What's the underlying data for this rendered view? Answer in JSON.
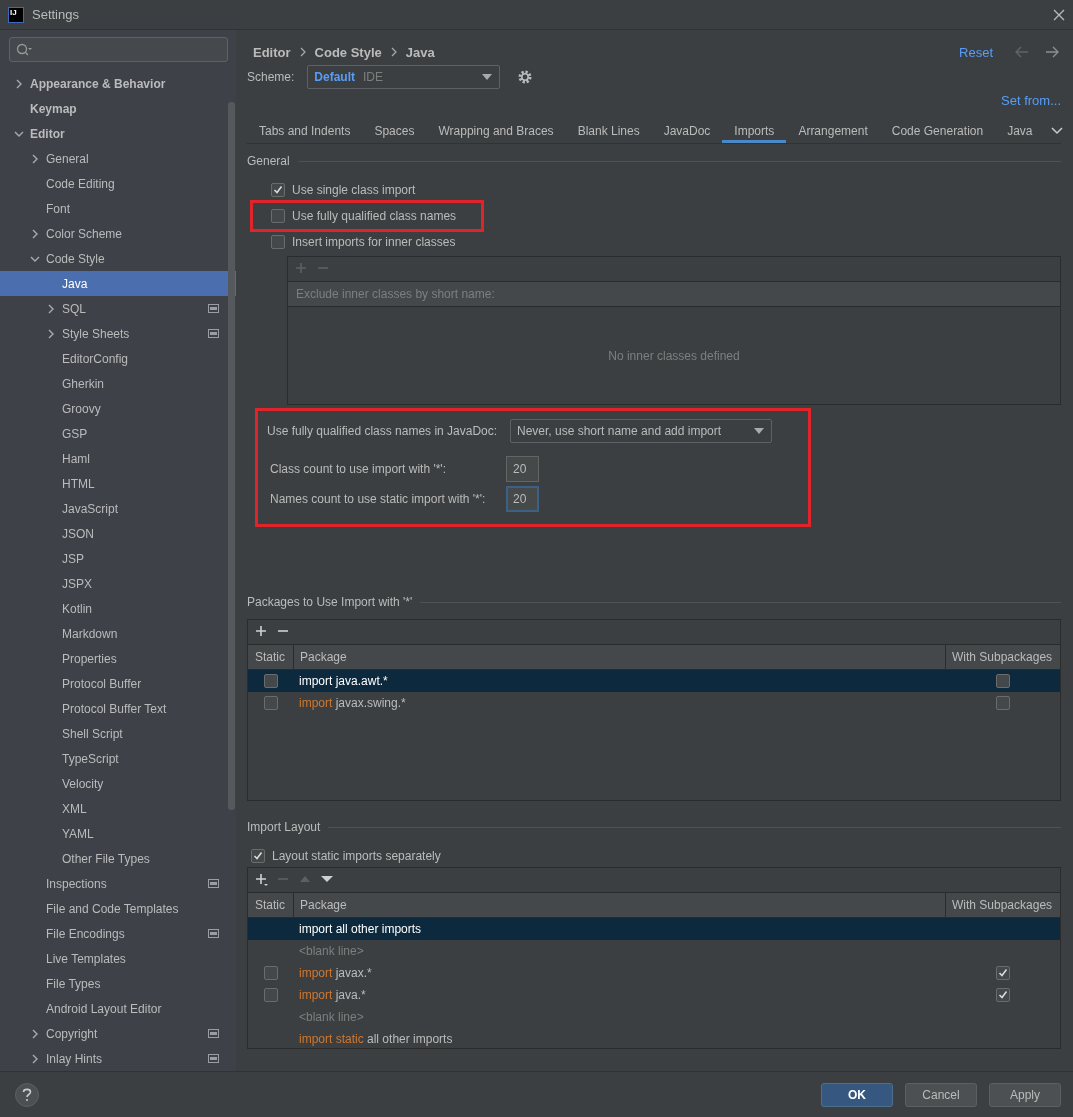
{
  "window": {
    "title": "Settings",
    "logo_text": "IJ"
  },
  "sidebar": {
    "items": [
      {
        "label": "Appearance & Behavior",
        "expanded": false,
        "selected": false
      },
      {
        "label": "Keymap",
        "selected": false
      },
      {
        "label": "Editor",
        "expanded": true,
        "selected": false,
        "children": [
          {
            "label": "General",
            "expanded": false,
            "selected": false
          },
          {
            "label": "Code Editing",
            "selected": false
          },
          {
            "label": "Font",
            "selected": false
          },
          {
            "label": "Color Scheme",
            "expanded": false,
            "selected": false
          },
          {
            "label": "Code Style",
            "expanded": true,
            "selected": false,
            "children": [
              {
                "label": "Java",
                "selected": true
              },
              {
                "label": "SQL",
                "expanded": false,
                "selected": false,
                "project_scope": true
              },
              {
                "label": "Style Sheets",
                "expanded": false,
                "selected": false,
                "project_scope": true
              },
              {
                "label": "EditorConfig",
                "selected": false
              },
              {
                "label": "Gherkin",
                "selected": false
              },
              {
                "label": "Groovy",
                "selected": false
              },
              {
                "label": "GSP",
                "selected": false
              },
              {
                "label": "Haml",
                "selected": false
              },
              {
                "label": "HTML",
                "selected": false
              },
              {
                "label": "JavaScript",
                "selected": false
              },
              {
                "label": "JSON",
                "selected": false
              },
              {
                "label": "JSP",
                "selected": false
              },
              {
                "label": "JSPX",
                "selected": false
              },
              {
                "label": "Kotlin",
                "selected": false
              },
              {
                "label": "Markdown",
                "selected": false
              },
              {
                "label": "Properties",
                "selected": false
              },
              {
                "label": "Protocol Buffer",
                "selected": false
              },
              {
                "label": "Protocol Buffer Text",
                "selected": false
              },
              {
                "label": "Shell Script",
                "selected": false
              },
              {
                "label": "TypeScript",
                "selected": false
              },
              {
                "label": "Velocity",
                "selected": false
              },
              {
                "label": "XML",
                "selected": false
              },
              {
                "label": "YAML",
                "selected": false
              },
              {
                "label": "Other File Types",
                "selected": false
              }
            ]
          },
          {
            "label": "Inspections",
            "selected": false,
            "project_scope": true
          },
          {
            "label": "File and Code Templates",
            "selected": false
          },
          {
            "label": "File Encodings",
            "selected": false,
            "project_scope": true
          },
          {
            "label": "Live Templates",
            "selected": false
          },
          {
            "label": "File Types",
            "selected": false
          },
          {
            "label": "Android Layout Editor",
            "selected": false
          },
          {
            "label": "Copyright",
            "expanded": false,
            "selected": false,
            "project_scope": true
          },
          {
            "label": "Inlay Hints",
            "expanded": false,
            "selected": false,
            "project_scope": true
          }
        ]
      }
    ]
  },
  "breadcrumb": [
    "Editor",
    "Code Style",
    "Java"
  ],
  "reset": "Reset",
  "scheme": {
    "label": "Scheme:",
    "name": "Default",
    "scope": "IDE"
  },
  "set_from": "Set from...",
  "tabs": [
    {
      "label": "Tabs and Indents",
      "selected": false
    },
    {
      "label": "Spaces",
      "selected": false
    },
    {
      "label": "Wrapping and Braces",
      "selected": false
    },
    {
      "label": "Blank Lines",
      "selected": false
    },
    {
      "label": "JavaDoc",
      "selected": false
    },
    {
      "label": "Imports",
      "selected": true
    },
    {
      "label": "Arrangement",
      "selected": false
    },
    {
      "label": "Code Generation",
      "selected": false
    },
    {
      "label": "Java",
      "selected": false
    }
  ],
  "general": {
    "title": "General",
    "options": [
      {
        "label": "Use single class import",
        "checked": true,
        "highlighted": false
      },
      {
        "label": "Use fully qualified class names",
        "checked": false,
        "highlighted": true
      },
      {
        "label": "Insert imports for inner classes",
        "checked": false,
        "highlighted": false
      }
    ],
    "inner_classes": {
      "toolbar": [
        {
          "kind": "add",
          "disabled": true
        },
        {
          "kind": "remove",
          "disabled": true
        }
      ],
      "column": "Exclude inner classes by short name:",
      "empty_text": "No inner classes defined"
    },
    "settings": {
      "highlighted": true,
      "javadoc": {
        "label": "Use fully qualified class names in JavaDoc:",
        "value": "Never, use short name and add import"
      },
      "fields": [
        {
          "label": "Class count to use import with '*':",
          "value": "20",
          "focused": false
        },
        {
          "label": "Names count to use static import with '*':",
          "value": "20",
          "focused": true
        }
      ]
    }
  },
  "packages": {
    "title": "Packages to Use Import with '*'",
    "toolbar": [
      {
        "kind": "add",
        "disabled": false
      },
      {
        "kind": "remove",
        "disabled": false
      }
    ],
    "columns": [
      "Static",
      "Package",
      "With Subpackages"
    ],
    "rows": [
      {
        "kind": "package",
        "static": false,
        "keyword": "import",
        "name": "java.awt.*",
        "with_subpackages": false,
        "selected": true
      },
      {
        "kind": "package",
        "static": false,
        "keyword": "import",
        "name": "javax.swing.*",
        "with_subpackages": false,
        "selected": false
      }
    ]
  },
  "import_layout": {
    "title": "Import Layout",
    "option": {
      "label": "Layout static imports separately",
      "checked": true
    },
    "toolbar": [
      {
        "kind": "add_menu",
        "disabled": false
      },
      {
        "kind": "remove",
        "disabled": true
      },
      {
        "kind": "up",
        "disabled": true
      },
      {
        "kind": "down",
        "disabled": false
      }
    ],
    "columns": [
      "Static",
      "Package",
      "With Subpackages"
    ],
    "rows": [
      {
        "kind": "other",
        "keyword": "import",
        "name": "all other imports",
        "selected": true
      },
      {
        "kind": "blank",
        "text": "<blank line>",
        "selected": false
      },
      {
        "kind": "package",
        "static": false,
        "keyword": "import",
        "name": "javax.*",
        "with_subpackages": true,
        "selected": false
      },
      {
        "kind": "package",
        "static": false,
        "keyword": "import",
        "name": "java.*",
        "with_subpackages": true,
        "selected": false
      },
      {
        "kind": "blank",
        "text": "<blank line>",
        "selected": false
      },
      {
        "kind": "other",
        "keyword": "import static",
        "name": "all other imports",
        "selected": false
      }
    ]
  },
  "buttons": [
    {
      "label": "OK",
      "kind": "primary"
    },
    {
      "label": "Cancel",
      "kind": "default"
    },
    {
      "label": "Apply",
      "kind": "default"
    }
  ]
}
